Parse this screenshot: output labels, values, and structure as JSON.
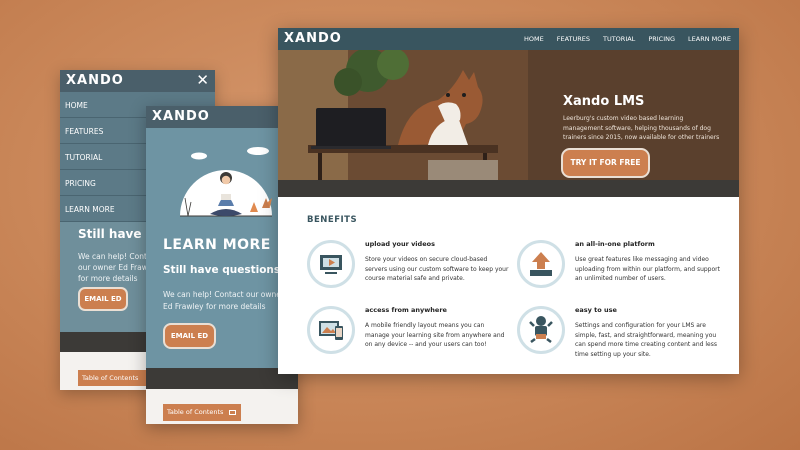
{
  "back_phone": {
    "logo": "XANDO",
    "close_glyph": "✕",
    "menu_items": [
      "HOME",
      "FEATURES",
      "TUTORIAL",
      "PRICING",
      "LEARN MORE"
    ],
    "heading": "Still have questions?",
    "text": "We can help! Contact our owner Ed Frawley for more details",
    "button": "EMAIL ED",
    "toc": "Table of Contents"
  },
  "front_phone": {
    "logo": "XANDO",
    "section_title": "LEARN MORE",
    "heading": "Still have questions?",
    "text": "We can help! Contact our owner Ed Frawley for more details",
    "button": "EMAIL ED",
    "toc": "Table of Contents"
  },
  "desktop": {
    "logo": "XANDO",
    "nav": [
      "HOME",
      "FEATURES",
      "TUTORIAL",
      "PRICING",
      "LEARN MORE"
    ],
    "hero": {
      "title": "Xando LMS",
      "text": "Leerburg's custom video based learning management software, helping thousands of dog trainers since 2015, now available for other trainers",
      "button": "TRY IT FOR FREE"
    },
    "benefits_heading": "BENEFITS",
    "features": [
      {
        "title": "upload your videos",
        "text": "Store your videos on secure cloud-based servers using our custom software to keep your course material safe and private.",
        "icon": "video-upload-icon"
      },
      {
        "title": "an all-in-one platform",
        "text": "Use great features like messaging and video uploading from within our platform, and support an unlimited number of users.",
        "icon": "upload-arrow-icon"
      },
      {
        "title": "access from anywhere",
        "text": "A mobile friendly layout means you can manage your learning site from anywhere and on any device -- and your users can too!",
        "icon": "devices-icon"
      },
      {
        "title": "easy to use",
        "text": "Settings and configuration for your LMS are simple, fast, and straightforward, meaning you can spend more time creating content and less time setting up your site.",
        "icon": "baby-easy-icon"
      }
    ]
  },
  "colors": {
    "header_teal": "#39555f",
    "accent_orange": "#cc7f4f",
    "phone_blue": "#6e94a3",
    "dark_band": "#3c3a37",
    "background": "#c98658"
  }
}
